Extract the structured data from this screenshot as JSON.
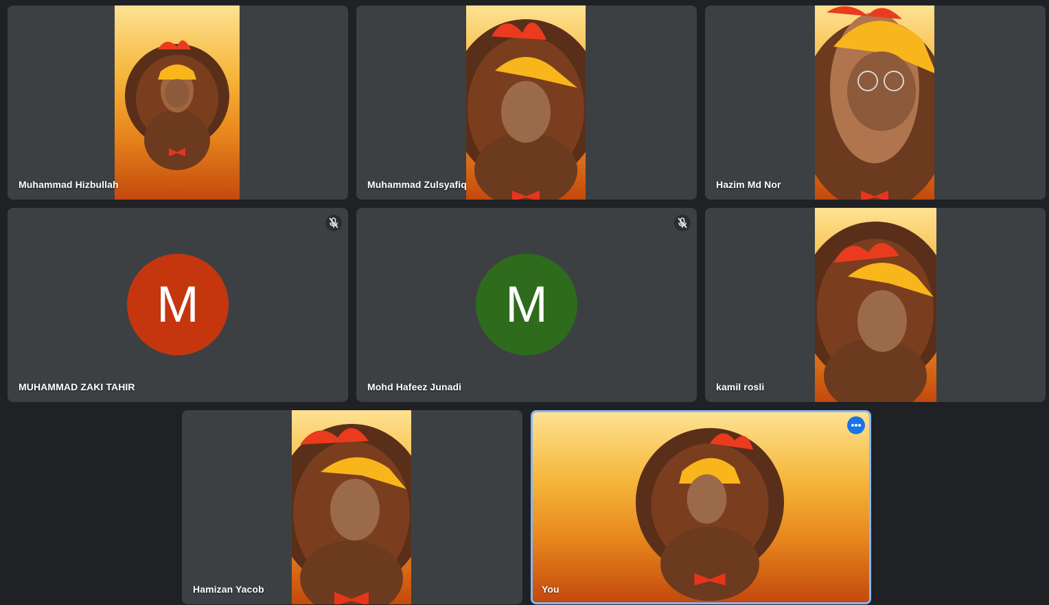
{
  "meeting": {
    "participants": [
      {
        "name": "Muhammad Hizbullah",
        "state": "video"
      },
      {
        "name": "Muhammad Zulsyafiq",
        "state": "video"
      },
      {
        "name": "Hazim Md Nor",
        "state": "video"
      },
      {
        "name": "MUHAMMAD ZAKI TAHIR",
        "state": "avatar",
        "initial": "M",
        "avatar_color": "#c5360e",
        "muted": true
      },
      {
        "name": "Mohd Hafeez Junadi",
        "state": "avatar",
        "initial": "M",
        "avatar_color": "#2e6b1c",
        "muted": true
      },
      {
        "name": "kamil rosli",
        "state": "video"
      },
      {
        "name": "Hamizan Yacob",
        "state": "video"
      },
      {
        "name": "You",
        "state": "video",
        "is_self": true
      }
    ]
  },
  "icons": {
    "muted": "mic-off-icon",
    "more": "more-options-icon"
  },
  "colors": {
    "background": "#202124",
    "tile": "#3c4043",
    "self_border": "#8ab4f8",
    "more_button": "#1a73e8"
  }
}
